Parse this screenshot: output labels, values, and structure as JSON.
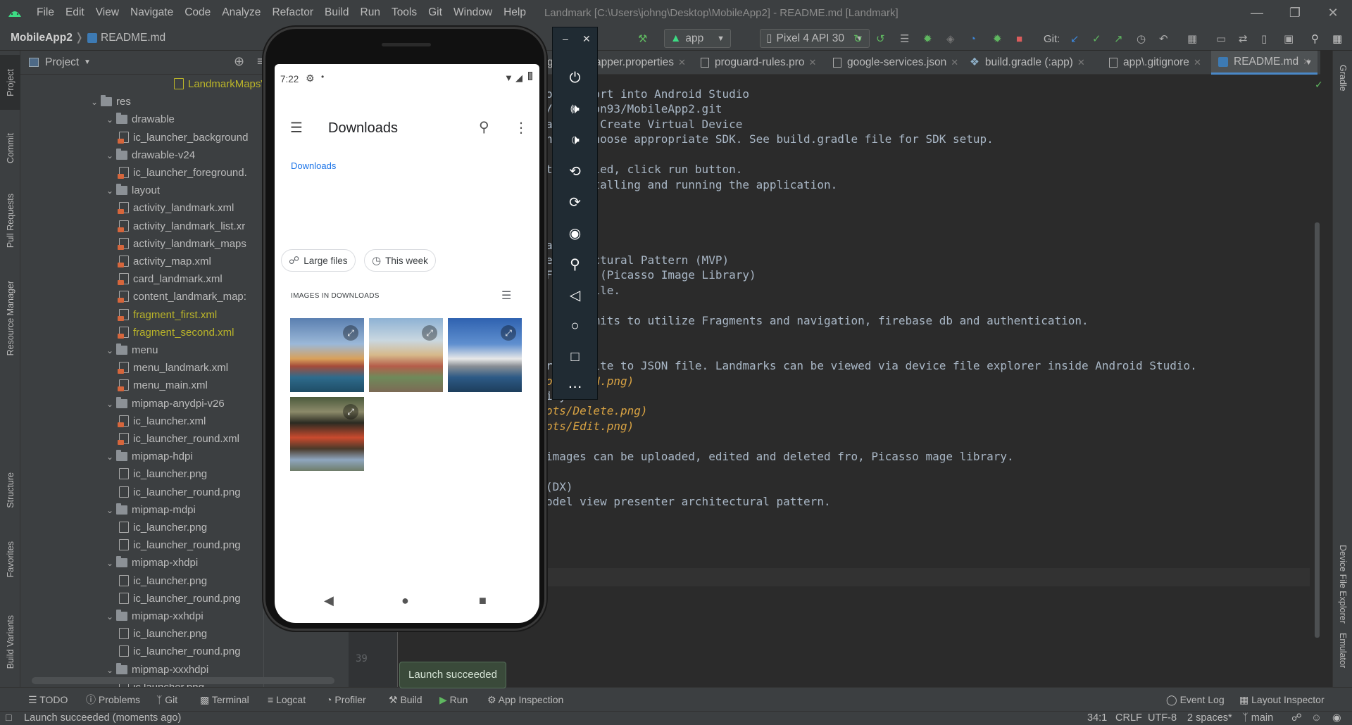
{
  "titlebar": {
    "menu": [
      "File",
      "Edit",
      "View",
      "Navigate",
      "Code",
      "Analyze",
      "Refactor",
      "Build",
      "Run",
      "Tools",
      "Git",
      "Window",
      "Help"
    ],
    "window_title": "Landmark [C:\\Users\\johng\\Desktop\\MobileApp2] - README.md [Landmark]"
  },
  "breadcrumb": {
    "project": "MobileApp2",
    "file": "README.md"
  },
  "toolbar": {
    "run_config": "app",
    "device": "Pixel 4 API 30",
    "git_label": "Git:"
  },
  "project_panel": {
    "title": "Project",
    "tree": [
      {
        "label": "LandmarkMapsV",
        "type": "module",
        "indent": 0,
        "color": "#bbb529"
      },
      {
        "label": "res",
        "type": "folder",
        "indent": 1,
        "open": true
      },
      {
        "label": "drawable",
        "type": "folder",
        "indent": 2,
        "open": true
      },
      {
        "label": "ic_launcher_background",
        "type": "xml",
        "indent": 3
      },
      {
        "label": "drawable-v24",
        "type": "folder",
        "indent": 2,
        "open": true
      },
      {
        "label": "ic_launcher_foreground.",
        "type": "xml",
        "indent": 3
      },
      {
        "label": "layout",
        "type": "folder",
        "indent": 2,
        "open": true
      },
      {
        "label": "activity_landmark.xml",
        "type": "xml",
        "indent": 3
      },
      {
        "label": "activity_landmark_list.xr",
        "type": "xml",
        "indent": 3
      },
      {
        "label": "activity_landmark_maps",
        "type": "xml",
        "indent": 3
      },
      {
        "label": "activity_map.xml",
        "type": "xml",
        "indent": 3
      },
      {
        "label": "card_landmark.xml",
        "type": "xml",
        "indent": 3
      },
      {
        "label": "content_landmark_map:",
        "type": "xml",
        "indent": 3
      },
      {
        "label": "fragment_first.xml",
        "type": "xml",
        "indent": 3,
        "color": "#bbb529"
      },
      {
        "label": "fragment_second.xml",
        "type": "xml",
        "indent": 3,
        "color": "#bbb529"
      },
      {
        "label": "menu",
        "type": "folder",
        "indent": 2,
        "open": true
      },
      {
        "label": "menu_landmark.xml",
        "type": "xml",
        "indent": 3
      },
      {
        "label": "menu_main.xml",
        "type": "xml",
        "indent": 3
      },
      {
        "label": "mipmap-anydpi-v26",
        "type": "folder",
        "indent": 2,
        "open": true
      },
      {
        "label": "ic_launcher.xml",
        "type": "xml",
        "indent": 3
      },
      {
        "label": "ic_launcher_round.xml",
        "type": "xml",
        "indent": 3
      },
      {
        "label": "mipmap-hdpi",
        "type": "folder",
        "indent": 2,
        "open": true
      },
      {
        "label": "ic_launcher.png",
        "type": "png",
        "indent": 3
      },
      {
        "label": "ic_launcher_round.png",
        "type": "png",
        "indent": 3
      },
      {
        "label": "mipmap-mdpi",
        "type": "folder",
        "indent": 2,
        "open": true
      },
      {
        "label": "ic_launcher.png",
        "type": "png",
        "indent": 3
      },
      {
        "label": "ic_launcher_round.png",
        "type": "png",
        "indent": 3
      },
      {
        "label": "mipmap-xhdpi",
        "type": "folder",
        "indent": 2,
        "open": true
      },
      {
        "label": "ic_launcher.png",
        "type": "png",
        "indent": 3
      },
      {
        "label": "ic_launcher_round.png",
        "type": "png",
        "indent": 3
      },
      {
        "label": "mipmap-xxhdpi",
        "type": "folder",
        "indent": 2,
        "open": true
      },
      {
        "label": "ic_launcher.png",
        "type": "png",
        "indent": 3
      },
      {
        "label": "ic_launcher_round.png",
        "type": "png",
        "indent": 3
      },
      {
        "label": "mipmap-xxxhdpi",
        "type": "folder",
        "indent": 2,
        "open": true
      },
      {
        "label": "ic launcher.png",
        "type": "png",
        "indent": 3
      }
    ]
  },
  "left_stripe": [
    "Project",
    "Commit",
    "Pull Requests",
    "Resource Manager",
    "Structure",
    "Favorites",
    "Build Variants"
  ],
  "right_stripe": [
    "Gradle",
    "Device File Explorer",
    "Emulator"
  ],
  "editor": {
    "tabs": [
      {
        "label": "g",
        "active": false
      },
      {
        "label": "apper.properties",
        "active": false
      },
      {
        "label": "proguard-rules.pro",
        "active": false
      },
      {
        "label": "google-services.json",
        "active": false
      },
      {
        "label": "build.gradle (:app)",
        "active": false
      },
      {
        "label": "app\\.gitignore",
        "active": false
      },
      {
        "label": "README.md",
        "active": true
      }
    ],
    "line_number": "39",
    "lines": [
      {
        "text": "o   import into Android Studio",
        "link": false
      },
      {
        "text": "/   eeson93/MobileApp2.git",
        "link": false
      },
      {
        "text": "a   < + Create Virtual Device",
        "link": false
      },
      {
        "text": "n   & choose appropriate SDK. See build.gradle file for SDK setup.",
        "link": false
      },
      {
        "text": "",
        "link": false
      },
      {
        "text": "t   talled, click run button.",
        "link": false
      },
      {
        "text": "    installing and running the application.",
        "link": false
      },
      {
        "text": "",
        "link": false
      },
      {
        "text": "",
        "link": false
      },
      {
        "text": "",
        "link": false
      },
      {
        "text": "a",
        "link": false
      },
      {
        "text": "e   itectural Pattern (MVP)",
        "link": false
      },
      {
        "text": "F   age (Picasso Image Library)",
        "link": false
      },
      {
        "text": "    ) file.",
        "link": false
      },
      {
        "text": "",
        "link": false
      },
      {
        "text": "    commits to utilize Fragments and navigation, firebase db and authentication.",
        "link": false
      },
      {
        "text": "",
        "link": false
      },
      {
        "text": "",
        "link": false
      },
      {
        "text": "read/write to JSON file. Landmarks can be viewed via device file explorer inside Android Studio.",
        "link": false
      },
      {
        "text": "ots/JSON.png)",
        "link": true
      },
      {
        "text": "ity",
        "link": false
      },
      {
        "text": "ots/Delete.png)",
        "link": true
      },
      {
        "text": "ots/Edit.png)",
        "link": true
      },
      {
        "text": "",
        "link": false
      },
      {
        "text": "images can be uploaded, edited and deleted fro, Picasso mage library.",
        "link": false
      },
      {
        "text": "",
        "link": false
      },
      {
        "text": "(DX)",
        "link": false
      },
      {
        "text": "odel view presenter architectural pattern.",
        "link": false
      }
    ]
  },
  "emulator": {
    "status_time": "7:22",
    "app_title": "Downloads",
    "breadcrumb": "Downloads",
    "chips": [
      "Large files",
      "This week"
    ],
    "section_header": "IMAGES IN DOWNLOADS"
  },
  "toast": "Launch succeeded",
  "bottom_tools": [
    "TODO",
    "Problems",
    "Git",
    "Terminal",
    "Logcat",
    "Profiler",
    "Build",
    "Run",
    "App Inspection"
  ],
  "bottom_right_tools": [
    "Event Log",
    "Layout Inspector"
  ],
  "status": {
    "message": "Launch succeeded (moments ago)",
    "position": "34:1",
    "line_sep": "CRLF",
    "encoding": "UTF-8",
    "indent": "2 spaces*",
    "branch": "main"
  },
  "colors": {
    "accent": "#4a88c7",
    "module": "#bbb529",
    "link": "#d9a343",
    "android_blue": "#1a73e8"
  }
}
